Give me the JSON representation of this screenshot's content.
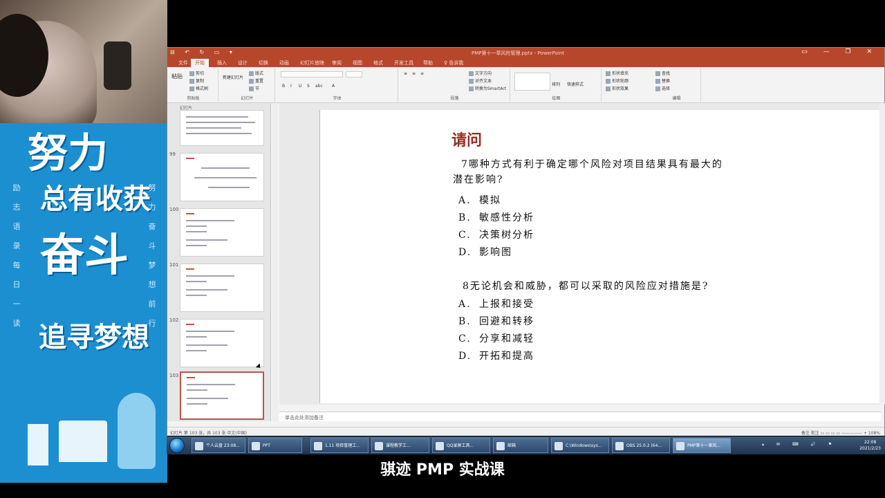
{
  "promo": {
    "line1": "努力",
    "line2": "总有收获",
    "line3": "奋斗",
    "line4": "追寻梦想",
    "left_column": [
      "励",
      "志",
      "语",
      "录",
      "每",
      "日",
      "一",
      "读"
    ],
    "right_column": [
      "努",
      "力",
      "奋",
      "斗",
      "梦",
      "想",
      "前",
      "行"
    ]
  },
  "window": {
    "title": "PMP第十一章风险管理.pptx - PowerPoint",
    "quick_access": "⊟ ↶ ↻ ▭ ▾",
    "controls": "▭ — ❐ ✕"
  },
  "ribbon": {
    "tabs": [
      "文件",
      "开始",
      "插入",
      "设计",
      "切换",
      "动画",
      "幻灯片放映",
      "审阅",
      "视图",
      "格式",
      "开发工具",
      "帮助",
      "♀ 告诉我"
    ],
    "active_tab": "开始",
    "groups": [
      {
        "label": "剪贴板",
        "buttons": [
          "粘贴",
          "剪切",
          "复制",
          "格式刷"
        ]
      },
      {
        "label": "幻灯片",
        "buttons": [
          "新建幻灯片",
          "版式",
          "重置",
          "节"
        ]
      },
      {
        "label": "字体",
        "buttons": [
          "B",
          "I",
          "U",
          "S",
          "abc",
          "A"
        ]
      },
      {
        "label": "段落",
        "buttons": [
          "≡",
          "≡",
          "≡",
          "文字方向",
          "对齐文本",
          "转换为SmartArt"
        ]
      },
      {
        "label": "绘图",
        "buttons": [
          "形状",
          "排列",
          "快速样式",
          "形状填充",
          "形状轮廓",
          "形状效果"
        ]
      },
      {
        "label": "编辑",
        "buttons": [
          "查找",
          "替换",
          "选择"
        ]
      }
    ]
  },
  "thumbnails": {
    "pane_label": "幻灯片",
    "items": [
      {
        "num": "",
        "selected": false
      },
      {
        "num": "99",
        "selected": false
      },
      {
        "num": "100",
        "selected": false
      },
      {
        "num": "101",
        "selected": false
      },
      {
        "num": "102",
        "selected": false
      },
      {
        "num": "103",
        "selected": true
      }
    ]
  },
  "slide": {
    "title": "请问",
    "q7_line1": "7哪种方式有利于确定哪个风险对项目结果具有最大的",
    "q7_line2": "潜在影响?",
    "q7_options": [
      {
        "letter": "A.",
        "text": "模拟"
      },
      {
        "letter": "B.",
        "text": "敏感性分析"
      },
      {
        "letter": "C.",
        "text": "决策树分析"
      },
      {
        "letter": "D.",
        "text": "影响图"
      }
    ],
    "q8": "8无论机会和威胁，都可以采取的风险应对措施是?",
    "q8_options": [
      {
        "letter": "A.",
        "text": "上报和接受"
      },
      {
        "letter": "B.",
        "text": "回避和转移"
      },
      {
        "letter": "C.",
        "text": "分享和减轻"
      },
      {
        "letter": "D.",
        "text": "开拓和提高"
      }
    ]
  },
  "notes": {
    "placeholder": "单击此处添加备注"
  },
  "status": {
    "left": "幻灯片 第 103 张，共 103 张    中文(中国)",
    "right": "备注  批注    ▭ ▭ ▭ ▭   —————   + 108%"
  },
  "taskbar": {
    "tasks": [
      "个人云盘 23:08...",
      "PPT",
      "1.11 项目管理工...",
      "课程教学工...",
      "QQ录屏工具...",
      "邮箱",
      "C:\\Windows\\sys...",
      "OBS 25.0.2 (64...",
      "PMP第十一章风..."
    ],
    "active_index": 8,
    "tray_icons": "▴ ✉ ⌨ 🔊 ⚑",
    "time": "22:08",
    "date": "2021/2/23"
  },
  "subtitle": "骐迹 PMP 实战课"
}
